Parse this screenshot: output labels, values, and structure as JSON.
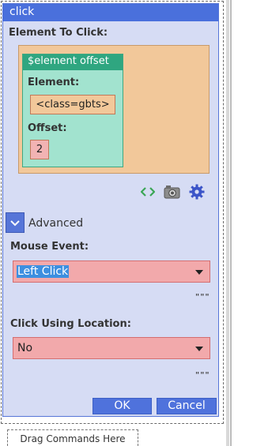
{
  "panel": {
    "title": "click",
    "element_to_click_label": "Element To Click:",
    "offset_block": {
      "title": "$element offset",
      "element_label": "Element:",
      "element_value": "<class=gbts>",
      "offset_label": "Offset:",
      "offset_value": "2"
    },
    "tool_icons": [
      "code-brackets-icon",
      "camera-icon",
      "gear-icon"
    ],
    "advanced_label": "Advanced",
    "mouse_event": {
      "label": "Mouse Event:",
      "selected": "Left Click"
    },
    "click_using_location": {
      "label": "Click Using Location:",
      "selected": "No"
    },
    "ellipsis": "\"\"\"",
    "ok_label": "OK",
    "cancel_label": "Cancel"
  },
  "drag_area": {
    "text": "Drag Commands Here"
  },
  "colors": {
    "title_bar": "#4a70dc",
    "panel_bg": "#d6dcf4",
    "orange_block": "#f2c89a",
    "green_block": "#a2e3cf",
    "green_title": "#2fa680",
    "select_bg": "#f2a9ab",
    "button": "#4f72dc",
    "selection_highlight": "#3d8fe0"
  }
}
